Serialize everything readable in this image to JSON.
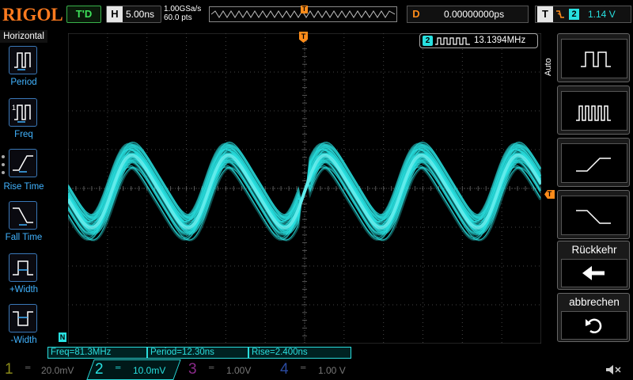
{
  "brand": {
    "logo": "RIGOL",
    "run_status": "T'D"
  },
  "timebase": {
    "key": "H",
    "scale": "5.00ns",
    "sample_rate": "1.00GSa/s",
    "points": "60.0 pts"
  },
  "delay": {
    "key": "D",
    "value": "0.00000000ps"
  },
  "trigger": {
    "key": "T",
    "edge_icon": "falling-edge-icon",
    "source": "2",
    "level": "1.14 V",
    "marker": "T"
  },
  "left_menu": {
    "title": "Horizontal",
    "items": [
      {
        "label": "Period",
        "icon": "period-icon"
      },
      {
        "label": "Freq",
        "icon": "freq-icon"
      },
      {
        "label": "Rise Time",
        "icon": "rise-time-icon"
      },
      {
        "label": "Fall Time",
        "icon": "fall-time-icon"
      },
      {
        "label": "+Width",
        "icon": "pos-width-icon"
      },
      {
        "label": "-Width",
        "icon": "neg-width-icon"
      }
    ]
  },
  "freq_counter": {
    "channel": "2",
    "value": "13.1394MHz"
  },
  "right_menu": {
    "auto_label": "Auto",
    "back_label": "Rückkehr",
    "cancel_label": "abbrechen"
  },
  "measurements": [
    {
      "text": "Freq=81.3MHz"
    },
    {
      "text": "Period=12.30ns"
    },
    {
      "text": "Rise=2.400ns"
    }
  ],
  "channels": [
    {
      "num": "1",
      "scale": "20.0mV",
      "color": "#8a8a1a"
    },
    {
      "num": "2",
      "scale": "10.0mV",
      "color": "#28e0e0"
    },
    {
      "num": "3",
      "scale": "1.00V",
      "color": "#8a2a8a"
    },
    {
      "num": "4",
      "scale": "1.00 V",
      "color": "#2a4aa0"
    }
  ],
  "markers": {
    "left_channel": "N",
    "right_trigger": "T"
  },
  "colors": {
    "accent": "#ff8c1a",
    "ch2": "#28e0e0",
    "menu_blue": "#41b3ff",
    "grid": "#3a3a3a"
  }
}
